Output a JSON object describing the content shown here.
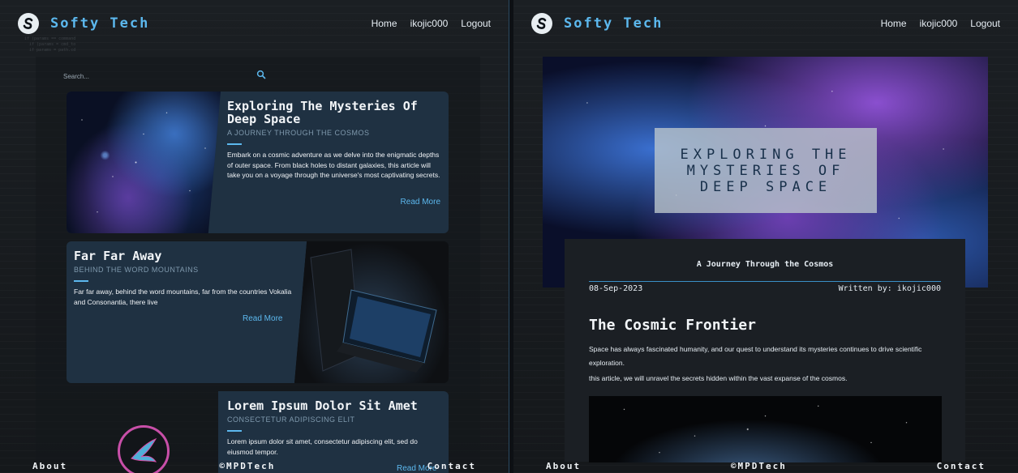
{
  "left": {
    "nav": {
      "brand": "Softy Tech",
      "links": [
        "Home",
        "ikojic000",
        "Logout"
      ]
    },
    "search": {
      "placeholder": "Search..."
    },
    "posts": [
      {
        "title": "Exploring The Mysteries Of Deep Space",
        "subtitle": "A JOURNEY THROUGH THE COSMOS",
        "description": "Embark on a cosmic adventure as we delve into the enigmatic depths of outer space. From black holes to distant galaxies, this article will take you on a voyage through the universe's most captivating secrets.",
        "read_more": "Read More"
      },
      {
        "title": "Far Far Away",
        "subtitle": "BEHIND THE WORD MOUNTAINS",
        "description": "Far far away, behind the word mountains, far from the countries Vokalia and Consonantia, there live",
        "read_more": "Read More"
      },
      {
        "title": "Lorem Ipsum Dolor Sit Amet",
        "subtitle": "CONSECTETUR ADIPISCING ELIT",
        "description": "Lorem ipsum dolor sit amet, consectetur adipiscing elit, sed do eiusmod tempor.",
        "read_more": "Read More"
      }
    ],
    "footer": {
      "about": "About",
      "copyright": "©MPDTech",
      "contact": "Contact"
    }
  },
  "right": {
    "nav": {
      "brand": "Softy Tech",
      "links": [
        "Home",
        "ikojic000",
        "Logout"
      ]
    },
    "hero_title": "EXPLORING THE MYSTERIES OF DEEP SPACE",
    "article": {
      "subtitle": "A Journey Through the Cosmos",
      "date": "08-Sep-2023",
      "author": "Written by: ikojic000",
      "heading": "The Cosmic Frontier",
      "paragraph1": "Space has always fascinated humanity, and our quest to understand its mysteries continues to drive scientific exploration.",
      "paragraph2": "this article, we will unravel the secrets hidden within the vast expanse of the cosmos."
    },
    "footer": {
      "about": "About",
      "copyright": "©MPDTech",
      "contact": "Contact"
    }
  },
  "colors": {
    "accent": "#5cb8ee",
    "card": "#1f3142",
    "background": "#15181b"
  }
}
